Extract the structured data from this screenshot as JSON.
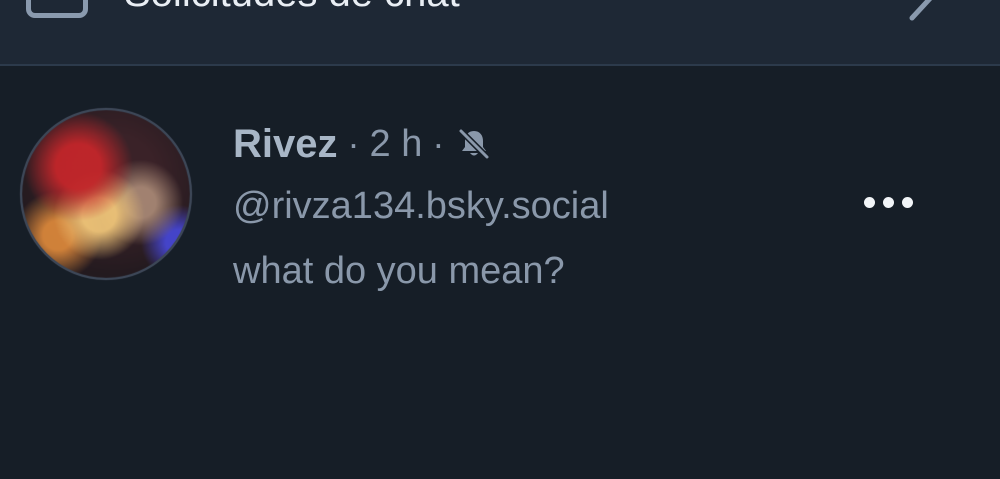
{
  "header": {
    "requests_label": "Solicitudes de chat",
    "requests_icon": "inbox-icon",
    "chevron_icon": "chevron-right-icon"
  },
  "conversation": {
    "name": "Rivez",
    "separator": "·",
    "time": "2 h",
    "muted_icon": "bell-slash-icon",
    "handle": "@rivza134.bsky.social",
    "last_message": "what do you mean?",
    "more_icon": "ellipsis-icon"
  },
  "colors": {
    "background": "#161e27",
    "header_background": "#1e2835",
    "primary_text": "#a8b6c6",
    "secondary_text": "#8a98aa",
    "icon_light": "#f2f5f8"
  }
}
